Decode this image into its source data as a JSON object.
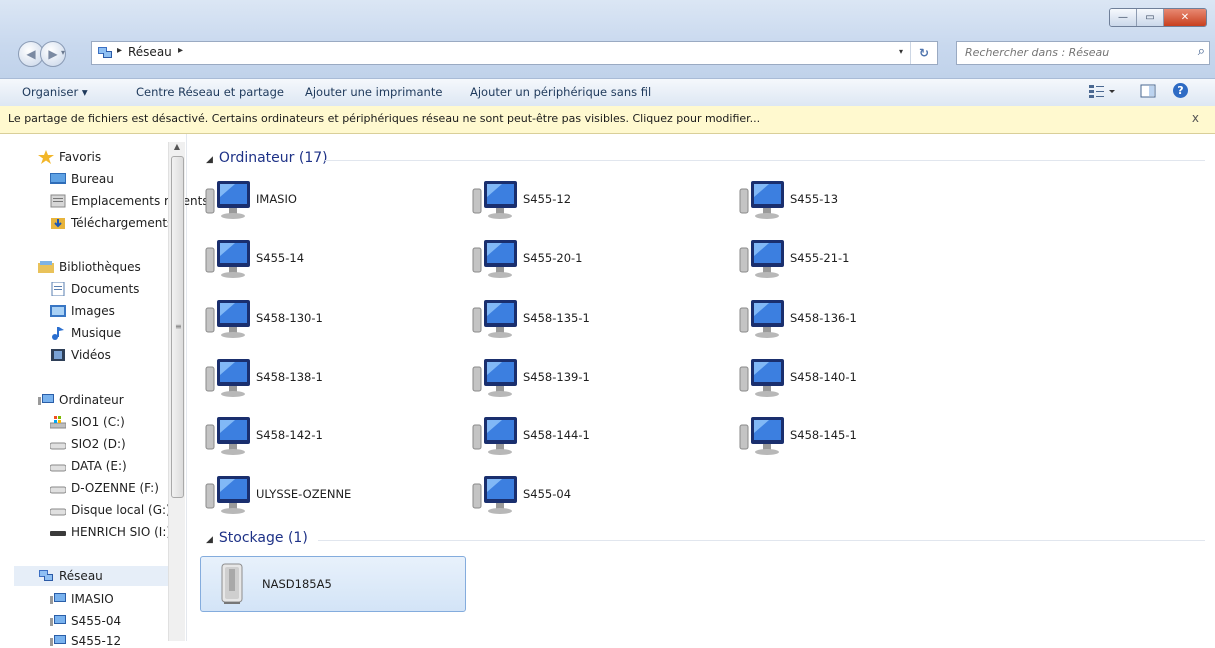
{
  "window": {
    "controls": {
      "minimize": "—",
      "maximize": "▭",
      "close": "✕"
    }
  },
  "navigation": {
    "back_icon": "◀",
    "forward_icon": "▶",
    "breadcrumb": "Réseau",
    "crumb_arrow": "▸",
    "dropdown": "▾",
    "refresh_icon": "↻",
    "search_placeholder": "Rechercher dans : Réseau",
    "search_icon": "⌕"
  },
  "toolbar": {
    "organize": "Organiser ▾",
    "network_center": "Centre Réseau et partage",
    "add_printer": "Ajouter une imprimante",
    "add_wireless": "Ajouter un périphérique sans fil",
    "help": "?"
  },
  "infobar": {
    "message": "Le partage de fichiers est désactivé. Certains ordinateurs et périphériques réseau ne sont peut-être pas visibles. Cliquez pour modifier...",
    "close": "x"
  },
  "sidebar": {
    "favorites": "Favoris",
    "desktop": "Bureau",
    "recent": "Emplacements récents",
    "downloads": "Téléchargements",
    "libraries": "Bibliothèques",
    "documents": "Documents",
    "images": "Images",
    "music": "Musique",
    "videos": "Vidéos",
    "computer": "Ordinateur",
    "drives": [
      "SIO1 (C:)",
      "SIO2 (D:)",
      "DATA (E:)",
      "D-OZENNE (F:)",
      "Disque local (G:)",
      "HENRICH SIO (I:)"
    ],
    "network": "Réseau",
    "network_items": [
      "IMASIO",
      "S455-04",
      "S455-12"
    ]
  },
  "main": {
    "computers_header": "Ordinateur (17)",
    "computers": [
      "IMASIO",
      "S455-12",
      "S455-13",
      "S455-14",
      "S455-20-1",
      "S455-21-1",
      "S458-130-1",
      "S458-135-1",
      "S458-136-1",
      "S458-138-1",
      "S458-139-1",
      "S458-140-1",
      "S458-142-1",
      "S458-144-1",
      "S458-145-1",
      "ULYSSE-OZENNE",
      "S455-04"
    ],
    "storage_header": "Stockage (1)",
    "storage": [
      "NASD185A5"
    ]
  },
  "colors": {
    "accent": "#1e3287",
    "infobar": "#fff9cf",
    "selection": "#d3e4f7"
  }
}
